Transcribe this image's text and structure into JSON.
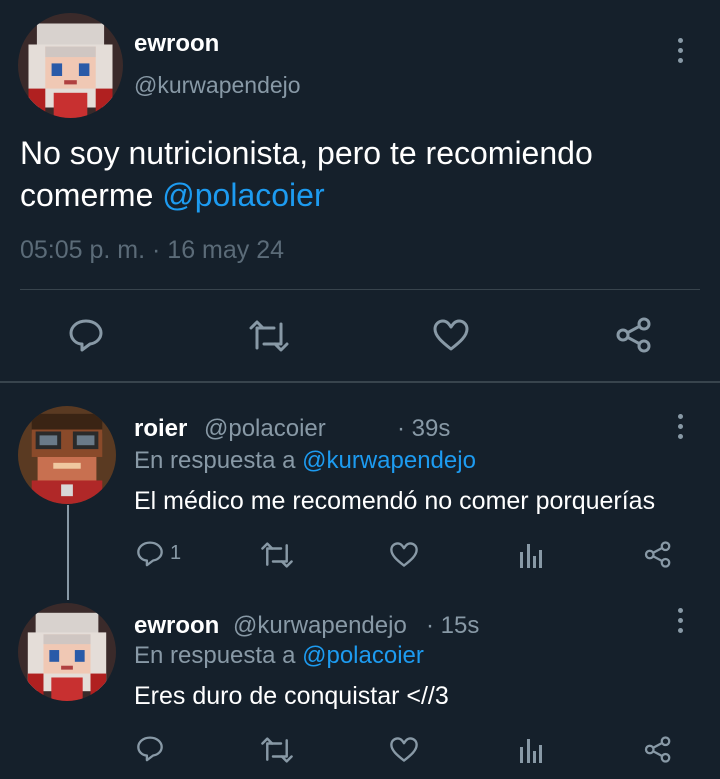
{
  "main_tweet": {
    "name": "ewroon",
    "handle": "@kurwapendejo",
    "text_before": "No soy nutricionista, pero te recomiendo comerme ",
    "mention": "@polacoier",
    "timestamp": "05:05 p. m. · 16 may 24",
    "icons": [
      "reply-icon",
      "retweet-icon",
      "like-icon",
      "share-icon",
      "more-icon"
    ]
  },
  "replies": [
    {
      "name": "roier",
      "handle": "@polacoier",
      "time": "· 39s",
      "in_reply_prefix": "En respuesta a",
      "in_reply_mention": "@kurwapendejo",
      "text": "El médico me recomendó no comer porquerías",
      "reply_count": "1"
    },
    {
      "name": "ewroon",
      "handle": "@kurwapendejo",
      "time": "· 15s",
      "in_reply_prefix": "En respuesta a",
      "in_reply_mention": "@polacoier",
      "text": "Eres duro de conquistar <//3",
      "reply_count": ""
    }
  ],
  "colors": {
    "background": "#15202b",
    "text_primary": "#ffffff",
    "text_secondary": "#8899a6",
    "mention": "#1d9bf0",
    "divider": "#38444d"
  }
}
